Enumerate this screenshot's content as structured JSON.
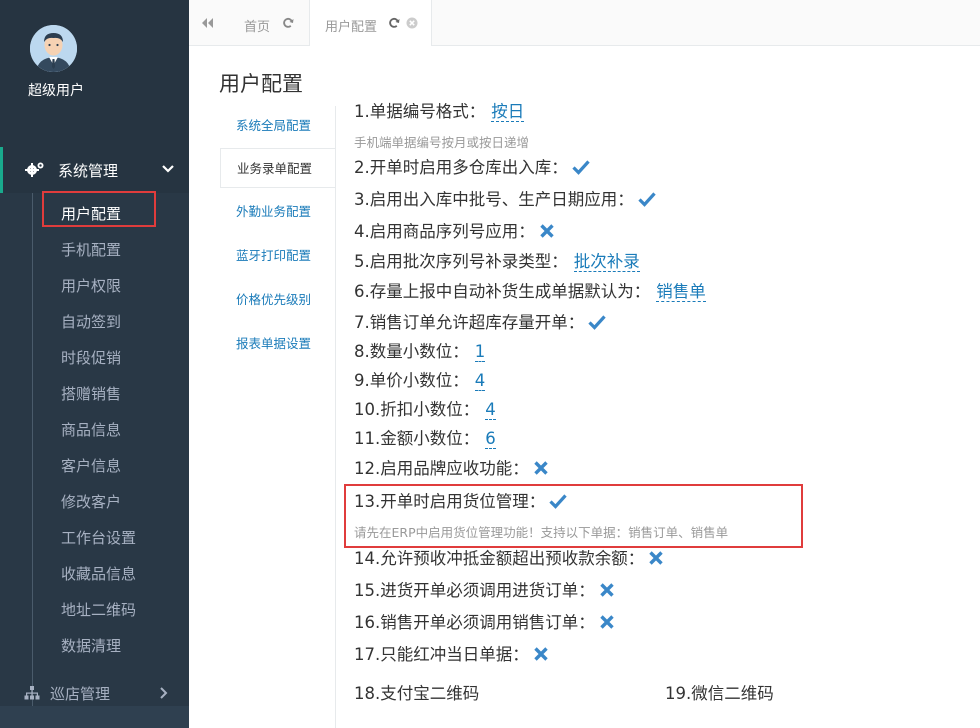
{
  "sidebar": {
    "user_name": "超级用户",
    "system_menu": "系统管理",
    "items": [
      {
        "label": "用户配置"
      },
      {
        "label": "手机配置"
      },
      {
        "label": "用户权限"
      },
      {
        "label": "自动签到"
      },
      {
        "label": "时段促销"
      },
      {
        "label": "搭赠销售"
      },
      {
        "label": "商品信息"
      },
      {
        "label": "客户信息"
      },
      {
        "label": "修改客户"
      },
      {
        "label": "工作台设置"
      },
      {
        "label": "收藏品信息"
      },
      {
        "label": "地址二维码"
      },
      {
        "label": "数据清理"
      }
    ],
    "shop_menu": "巡店管理"
  },
  "tabs": {
    "home": "首页",
    "user": "用户配置"
  },
  "page_title": "用户配置",
  "left_nav": [
    {
      "label": "系统全局配置"
    },
    {
      "label": "业务录单配置"
    },
    {
      "label": "外勤业务配置"
    },
    {
      "label": "蓝牙打印配置"
    },
    {
      "label": "价格优先级别"
    },
    {
      "label": "报表单据设置"
    }
  ],
  "settings": {
    "s1": {
      "label": "1.单据编号格式：",
      "value": "按日",
      "hint": "手机端单据编号按月或按日递增"
    },
    "s2": {
      "label": "2.开单时启用多仓库出入库：",
      "state": "check"
    },
    "s3": {
      "label": "3.启用出入库中批号、生产日期应用：",
      "state": "check"
    },
    "s4": {
      "label": "4.启用商品序列号应用：",
      "state": "cross"
    },
    "s5": {
      "label": "5.启用批次序列号补录类型：",
      "value": "批次补录"
    },
    "s6": {
      "label": "6.存量上报中自动补货生成单据默认为：",
      "value": "销售单"
    },
    "s7": {
      "label": "7.销售订单允许超库存量开单：",
      "state": "check"
    },
    "s8": {
      "label": "8.数量小数位：",
      "value": "1"
    },
    "s9": {
      "label": "9.单价小数位：",
      "value": "4"
    },
    "s10": {
      "label": "10.折扣小数位：",
      "value": "4"
    },
    "s11": {
      "label": "11.金额小数位：",
      "value": "6"
    },
    "s12": {
      "label": "12.启用品牌应收功能：",
      "state": "cross"
    },
    "s13": {
      "label": "13.开单时启用货位管理：",
      "state": "check",
      "hint": "请先在ERP中启用货位管理功能！支持以下单据：销售订单、销售单"
    },
    "s14": {
      "label": "14.允许预收冲抵金额超出预收款余额：",
      "state": "cross"
    },
    "s15": {
      "label": "15.进货开单必须调用进货订单：",
      "state": "cross"
    },
    "s16": {
      "label": "16.销售开单必须调用销售订单：",
      "state": "cross"
    },
    "s17": {
      "label": "17.只能红冲当日单据：",
      "state": "cross"
    },
    "s18": {
      "label": "18.支付宝二维码"
    },
    "s19": {
      "label": "19.微信二维码"
    }
  },
  "colors": {
    "accent": "#1a7bb9",
    "sidebar_bg": "#2f4050",
    "highlight_box": "#e03c3c"
  }
}
